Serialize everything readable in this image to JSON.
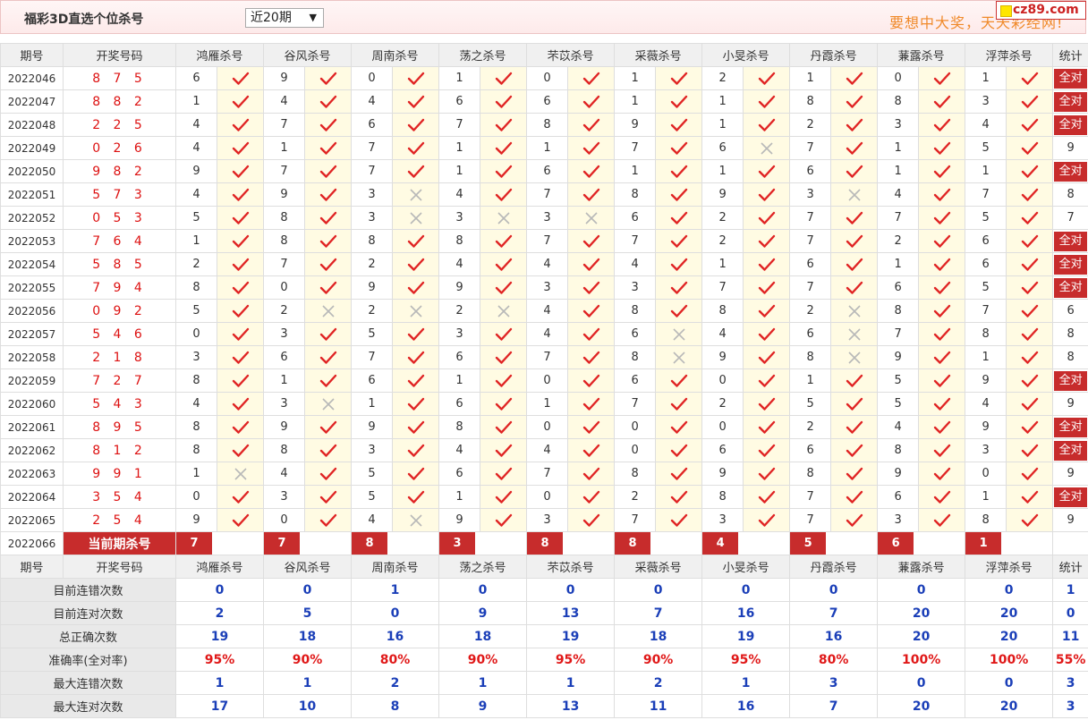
{
  "header": {
    "title": "福彩3D直选个位杀号",
    "range_select": "近20期",
    "promo": "要想中大奖，天天彩经网!",
    "logo": "cz89.com"
  },
  "columns": {
    "period": "期号",
    "draw": "开奖号码",
    "experts": [
      "鸿雁杀号",
      "谷风杀号",
      "周南杀号",
      "荡之杀号",
      "芣苡杀号",
      "采薇杀号",
      "小旻杀号",
      "丹霞杀号",
      "蒹露杀号",
      "浮萍杀号"
    ],
    "stat": "统计"
  },
  "rows": [
    {
      "period": "2022046",
      "draw": "8 7 5",
      "kills": [
        "6",
        "9",
        "0",
        "1",
        "0",
        "1",
        "2",
        "1",
        "0",
        "1"
      ],
      "marks": [
        1,
        1,
        1,
        1,
        1,
        1,
        1,
        1,
        1,
        1
      ],
      "stat": "全对"
    },
    {
      "period": "2022047",
      "draw": "8 8 2",
      "kills": [
        "1",
        "4",
        "4",
        "6",
        "6",
        "1",
        "1",
        "8",
        "8",
        "3"
      ],
      "marks": [
        1,
        1,
        1,
        1,
        1,
        1,
        1,
        1,
        1,
        1
      ],
      "stat": "全对"
    },
    {
      "period": "2022048",
      "draw": "2 2 5",
      "kills": [
        "4",
        "7",
        "6",
        "7",
        "8",
        "9",
        "1",
        "2",
        "3",
        "4"
      ],
      "marks": [
        1,
        1,
        1,
        1,
        1,
        1,
        1,
        1,
        1,
        1
      ],
      "stat": "全对"
    },
    {
      "period": "2022049",
      "draw": "0 2 6",
      "kills": [
        "4",
        "1",
        "7",
        "1",
        "1",
        "7",
        "6",
        "7",
        "1",
        "5"
      ],
      "marks": [
        1,
        1,
        1,
        1,
        1,
        1,
        0,
        1,
        1,
        1
      ],
      "stat": "9"
    },
    {
      "period": "2022050",
      "draw": "9 8 2",
      "kills": [
        "9",
        "7",
        "7",
        "1",
        "6",
        "1",
        "1",
        "6",
        "1",
        "1"
      ],
      "marks": [
        1,
        1,
        1,
        1,
        1,
        1,
        1,
        1,
        1,
        1
      ],
      "stat": "全对"
    },
    {
      "period": "2022051",
      "draw": "5 7 3",
      "kills": [
        "4",
        "9",
        "3",
        "4",
        "7",
        "8",
        "9",
        "3",
        "4",
        "7"
      ],
      "marks": [
        1,
        1,
        0,
        1,
        1,
        1,
        1,
        0,
        1,
        1
      ],
      "stat": "8"
    },
    {
      "period": "2022052",
      "draw": "0 5 3",
      "kills": [
        "5",
        "8",
        "3",
        "3",
        "3",
        "6",
        "2",
        "7",
        "7",
        "5"
      ],
      "marks": [
        1,
        1,
        0,
        0,
        0,
        1,
        1,
        1,
        1,
        1
      ],
      "stat": "7"
    },
    {
      "period": "2022053",
      "draw": "7 6 4",
      "kills": [
        "1",
        "8",
        "8",
        "8",
        "7",
        "7",
        "2",
        "7",
        "2",
        "6"
      ],
      "marks": [
        1,
        1,
        1,
        1,
        1,
        1,
        1,
        1,
        1,
        1
      ],
      "stat": "全对"
    },
    {
      "period": "2022054",
      "draw": "5 8 5",
      "kills": [
        "2",
        "7",
        "2",
        "4",
        "4",
        "4",
        "1",
        "6",
        "1",
        "6"
      ],
      "marks": [
        1,
        1,
        1,
        1,
        1,
        1,
        1,
        1,
        1,
        1
      ],
      "stat": "全对"
    },
    {
      "period": "2022055",
      "draw": "7 9 4",
      "kills": [
        "8",
        "0",
        "9",
        "9",
        "3",
        "3",
        "7",
        "7",
        "6",
        "5"
      ],
      "marks": [
        1,
        1,
        1,
        1,
        1,
        1,
        1,
        1,
        1,
        1
      ],
      "stat": "全对"
    },
    {
      "period": "2022056",
      "draw": "0 9 2",
      "kills": [
        "5",
        "2",
        "2",
        "2",
        "4",
        "8",
        "8",
        "2",
        "8",
        "7"
      ],
      "marks": [
        1,
        0,
        0,
        0,
        1,
        1,
        1,
        0,
        1,
        1
      ],
      "stat": "6"
    },
    {
      "period": "2022057",
      "draw": "5 4 6",
      "kills": [
        "0",
        "3",
        "5",
        "3",
        "4",
        "6",
        "4",
        "6",
        "7",
        "8"
      ],
      "marks": [
        1,
        1,
        1,
        1,
        1,
        0,
        1,
        0,
        1,
        1
      ],
      "stat": "8"
    },
    {
      "period": "2022058",
      "draw": "2 1 8",
      "kills": [
        "3",
        "6",
        "7",
        "6",
        "7",
        "8",
        "9",
        "8",
        "9",
        "1"
      ],
      "marks": [
        1,
        1,
        1,
        1,
        1,
        0,
        1,
        0,
        1,
        1
      ],
      "stat": "8"
    },
    {
      "period": "2022059",
      "draw": "7 2 7",
      "kills": [
        "8",
        "1",
        "6",
        "1",
        "0",
        "6",
        "0",
        "1",
        "5",
        "9"
      ],
      "marks": [
        1,
        1,
        1,
        1,
        1,
        1,
        1,
        1,
        1,
        1
      ],
      "stat": "全对"
    },
    {
      "period": "2022060",
      "draw": "5 4 3",
      "kills": [
        "4",
        "3",
        "1",
        "6",
        "1",
        "7",
        "2",
        "5",
        "5",
        "4"
      ],
      "marks": [
        1,
        0,
        1,
        1,
        1,
        1,
        1,
        1,
        1,
        1
      ],
      "stat": "9"
    },
    {
      "period": "2022061",
      "draw": "8 9 5",
      "kills": [
        "8",
        "9",
        "9",
        "8",
        "0",
        "0",
        "0",
        "2",
        "4",
        "9"
      ],
      "marks": [
        1,
        1,
        1,
        1,
        1,
        1,
        1,
        1,
        1,
        1
      ],
      "stat": "全对"
    },
    {
      "period": "2022062",
      "draw": "8 1 2",
      "kills": [
        "8",
        "8",
        "3",
        "4",
        "4",
        "0",
        "6",
        "6",
        "8",
        "3"
      ],
      "marks": [
        1,
        1,
        1,
        1,
        1,
        1,
        1,
        1,
        1,
        1
      ],
      "stat": "全对"
    },
    {
      "period": "2022063",
      "draw": "9 9 1",
      "kills": [
        "1",
        "4",
        "5",
        "6",
        "7",
        "8",
        "9",
        "8",
        "9",
        "0"
      ],
      "marks": [
        0,
        1,
        1,
        1,
        1,
        1,
        1,
        1,
        1,
        1
      ],
      "stat": "9"
    },
    {
      "period": "2022064",
      "draw": "3 5 4",
      "kills": [
        "0",
        "3",
        "5",
        "1",
        "0",
        "2",
        "8",
        "7",
        "6",
        "1"
      ],
      "marks": [
        1,
        1,
        1,
        1,
        1,
        1,
        1,
        1,
        1,
        1
      ],
      "stat": "全对"
    },
    {
      "period": "2022065",
      "draw": "2 5 4",
      "kills": [
        "9",
        "0",
        "4",
        "9",
        "3",
        "7",
        "3",
        "7",
        "3",
        "8"
      ],
      "marks": [
        1,
        1,
        0,
        1,
        1,
        1,
        1,
        1,
        1,
        1
      ],
      "stat": "9"
    }
  ],
  "current": {
    "period": "2022066",
    "label": "当前期杀号",
    "kills": [
      "7",
      "7",
      "8",
      "3",
      "8",
      "8",
      "4",
      "5",
      "6",
      "1"
    ]
  },
  "summary": [
    {
      "label": "目前连错次数",
      "values": [
        "0",
        "0",
        "1",
        "0",
        "0",
        "0",
        "0",
        "0",
        "0",
        "0"
      ],
      "stat": "1",
      "red": false
    },
    {
      "label": "目前连对次数",
      "values": [
        "2",
        "5",
        "0",
        "9",
        "13",
        "7",
        "16",
        "7",
        "20",
        "20"
      ],
      "stat": "0",
      "red": false
    },
    {
      "label": "总正确次数",
      "values": [
        "19",
        "18",
        "16",
        "18",
        "19",
        "18",
        "19",
        "16",
        "20",
        "20"
      ],
      "stat": "11",
      "red": false
    },
    {
      "label": "准确率(全对率)",
      "values": [
        "95%",
        "90%",
        "80%",
        "90%",
        "95%",
        "90%",
        "95%",
        "80%",
        "100%",
        "100%"
      ],
      "stat": "55%",
      "red": true
    },
    {
      "label": "最大连错次数",
      "values": [
        "1",
        "1",
        "2",
        "1",
        "1",
        "2",
        "1",
        "3",
        "0",
        "0"
      ],
      "stat": "3",
      "red": false
    },
    {
      "label": "最大连对次数",
      "values": [
        "17",
        "10",
        "8",
        "9",
        "13",
        "11",
        "16",
        "7",
        "20",
        "20"
      ],
      "stat": "3",
      "red": false
    }
  ],
  "colors": {
    "accent": "#c72c2c",
    "check": "#e02424",
    "cross": "#b8b8b8",
    "blue": "#1b3fb8",
    "mark_bg": "#fffbe3"
  }
}
